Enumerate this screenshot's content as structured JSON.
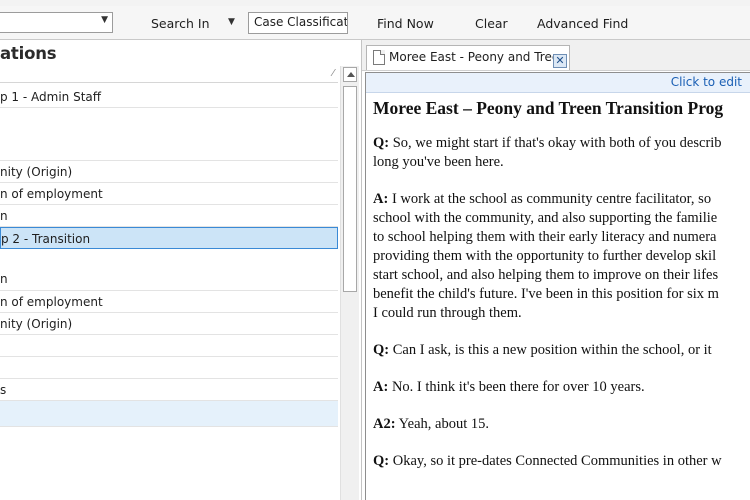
{
  "find_bar": {
    "search_in_label": "Search In",
    "scope_value": "Case Classificati",
    "find_now_label": "Find Now",
    "clear_label": "Clear",
    "advanced_find_label": "Advanced Find"
  },
  "left_pane": {
    "title": "ations",
    "sort_indicator": "⁄",
    "rows": [
      "p 1 - Admin Staff",
      "",
      "nity (Origin)",
      "n of employment",
      "n",
      "p 2 - Transition",
      "n",
      "n of employment",
      "nity (Origin)",
      "",
      "",
      "s",
      ""
    ]
  },
  "document": {
    "tab_label": "Moree East - Peony and Treen",
    "click_to_edit": "Click to edit",
    "title": "Moree East – Peony and Treen Transition Prog",
    "paragraphs": [
      {
        "speaker": "Q:",
        "lines": [
          "So, we might start if that's okay with both of you describ",
          "long you've been here."
        ]
      },
      {
        "speaker": "A:",
        "lines": [
          "I work at the school as community centre facilitator, so",
          "school with the community, and also supporting the familie",
          "to school helping them with their early literacy and numera",
          "providing them with the opportunity to further develop skil",
          "start school, and also helping them to improve on their lifes",
          "benefit the child's future. I've been in this position for six m",
          "I could run through them."
        ]
      },
      {
        "speaker": "Q:",
        "lines": [
          "Can I ask, is this a new position within the school, or it"
        ]
      },
      {
        "speaker": "A:",
        "lines": [
          "No. I think it's been there for over 10 years."
        ]
      },
      {
        "speaker": "A2:",
        "lines": [
          "Yeah, about 15."
        ]
      },
      {
        "speaker": "Q:",
        "lines": [
          "Okay, so it pre-dates Connected Communities in other w"
        ]
      }
    ]
  }
}
